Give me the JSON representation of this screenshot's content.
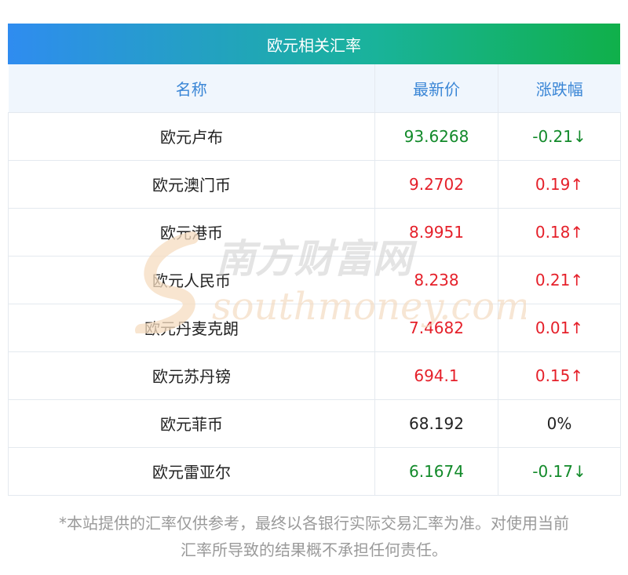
{
  "header": {
    "title": "欧元相关汇率"
  },
  "table": {
    "columns": [
      "名称",
      "最新价",
      "涨跌幅"
    ],
    "rows": [
      {
        "name": "欧元卢布",
        "price": "93.6268",
        "change": "-0.21↓",
        "direction": "down"
      },
      {
        "name": "欧元澳门币",
        "price": "9.2702",
        "change": "0.19↑",
        "direction": "up"
      },
      {
        "name": "欧元港币",
        "price": "8.9951",
        "change": "0.18↑",
        "direction": "up"
      },
      {
        "name": "欧元人民币",
        "price": "8.238",
        "change": "0.21↑",
        "direction": "up"
      },
      {
        "name": "欧元丹麦克朗",
        "price": "7.4682",
        "change": "0.01↑",
        "direction": "up"
      },
      {
        "name": "欧元苏丹镑",
        "price": "694.1",
        "change": "0.15↑",
        "direction": "up"
      },
      {
        "name": "欧元菲币",
        "price": "68.192",
        "change": "0%",
        "direction": "flat"
      },
      {
        "name": "欧元雷亚尔",
        "price": "6.1674",
        "change": "-0.17↓",
        "direction": "down"
      }
    ]
  },
  "watermark": {
    "cn": "南方财富网",
    "en": "southmoney.com"
  },
  "disclaimer": {
    "line1": "*本站提供的汇率仅供参考，最终以各银行实际交易汇率为准。对使用当前",
    "line2": "汇率所导致的结果概不承担任何责任。"
  },
  "colors": {
    "up": "#e5202a",
    "down": "#128a2a",
    "header_text": "#3a86d6",
    "title_gradient_start": "#2f8cf0",
    "title_gradient_end": "#10b04a"
  }
}
